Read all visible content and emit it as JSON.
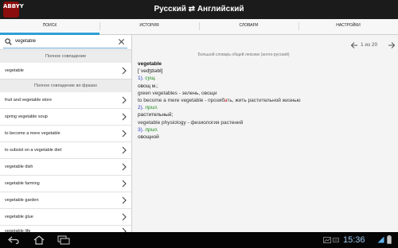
{
  "header": {
    "logo_text": "ABBYY",
    "title": "Русский ⇄ Английский"
  },
  "tabs": [
    {
      "label": "ПОИСК",
      "active": true
    },
    {
      "label": "ИСТОРИЯ",
      "active": false
    },
    {
      "label": "СЛОВАРИ",
      "active": false
    },
    {
      "label": "НАСТРОЙКИ",
      "active": false
    }
  ],
  "search": {
    "value": "vegetable"
  },
  "left": {
    "exact_header": "Полное совпадение",
    "exact_items": [
      "vegetable"
    ],
    "phrase_header": "Полное совпадение во фразах",
    "phrase_items": [
      "fruit and vegetable store",
      "spring vegetable soup",
      "to become a mere vegetable",
      "to subsist on a vegetable diet",
      "vegetable dish",
      "vegetable farming",
      "vegetable garden",
      "vegetable glue",
      "vegetable life"
    ]
  },
  "result": {
    "counter": "1 из 20",
    "dictionary": "Большой словарь общей лексики (англо-русский)",
    "headword": "vegetable",
    "transcription": "[ˈveʤɪtəbl]",
    "sense1_num": "1).",
    "sense1_pos": "сущ.",
    "sense1_trans": "овощ м.;",
    "sense1_ex1": "green vegetables - зелень, овощи",
    "sense1_ex2_a": "to become a mere vegetable - прозяб",
    "sense1_ex2_b": "а",
    "sense1_ex2_c": "ть, жить растительной жизнью",
    "sense2_num": "2).",
    "sense2_pos": "прил.",
    "sense2_trans": "растительный;",
    "sense2_ex1": "vegetable physiology - физиология растений",
    "sense3_num": "3).",
    "sense3_pos": "прил.",
    "sense3_trans": "овощной"
  },
  "system": {
    "clock": "15:36"
  },
  "colors": {
    "accent": "#2e9fd5",
    "pos_green": "#1e8a1e",
    "number_blue": "#2b3dc7",
    "stress_red": "#c02020",
    "clock_blue": "#9cc7ef"
  },
  "icons": [
    "search-icon",
    "clear-icon",
    "chevron-right-icon",
    "arrow-left-icon",
    "arrow-right-icon",
    "back-icon",
    "home-icon",
    "recent-apps-icon",
    "wifi-icon",
    "battery-icon"
  ]
}
